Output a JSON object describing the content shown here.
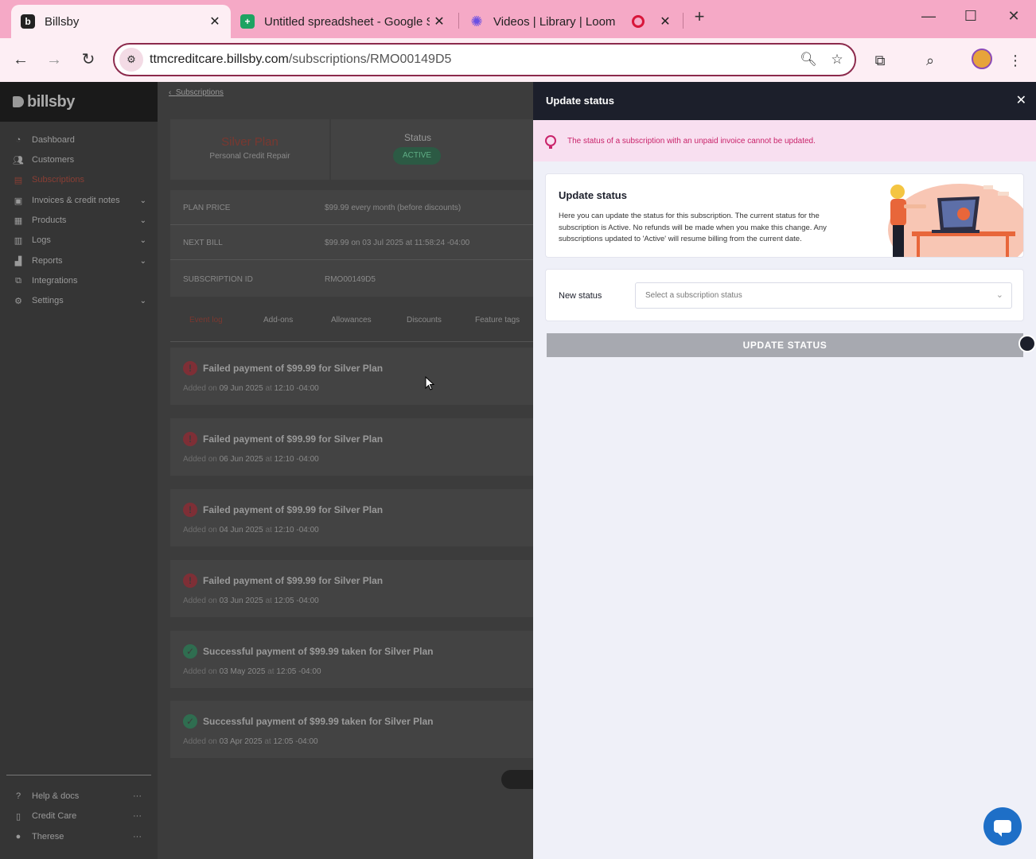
{
  "browser": {
    "tabs": [
      {
        "title": "Billsby",
        "favicon": "billsby-favicon",
        "close": "✕"
      },
      {
        "title": "Untitled spreadsheet - Google S",
        "favicon": "google-sheets-favicon",
        "close": "✕"
      },
      {
        "title": "Videos | Library | Loom",
        "favicon": "loom-favicon",
        "close": "✕"
      }
    ],
    "new_tab": "+",
    "url_domain": "ttmcreditcare.billsby.com",
    "url_path": "/subscriptions/RMO00149D5"
  },
  "sidebar": {
    "brand": "billsby",
    "items": [
      {
        "label": "Dashboard",
        "icon": "dashboard-icon"
      },
      {
        "label": "Customers",
        "icon": "customers-icon"
      },
      {
        "label": "Subscriptions",
        "icon": "subscriptions-icon"
      },
      {
        "label": "Invoices & credit notes",
        "icon": "invoices-icon"
      },
      {
        "label": "Products",
        "icon": "products-icon"
      },
      {
        "label": "Logs",
        "icon": "logs-icon"
      },
      {
        "label": "Reports",
        "icon": "reports-icon"
      },
      {
        "label": "Integrations",
        "icon": "integrations-icon"
      },
      {
        "label": "Settings",
        "icon": "settings-icon"
      }
    ],
    "footer": [
      {
        "label": "Help & docs",
        "icon": "help-icon"
      },
      {
        "label": "Credit Care",
        "icon": "building-icon"
      },
      {
        "label": "Therese",
        "icon": "user-icon"
      }
    ]
  },
  "main": {
    "breadcrumb": "Subscriptions",
    "plan_name": "Silver Plan",
    "plan_subtitle": "Personal Credit Repair",
    "status_label": "Status",
    "status_value": "ACTIVE",
    "details": [
      {
        "key": "PLAN PRICE",
        "value": "$99.99 every month (before discounts)"
      },
      {
        "key": "NEXT BILL",
        "value": "$99.99 on 03 Jul 2025 at 11:58:24 -04:00"
      },
      {
        "key": "SUBSCRIPTION ID",
        "value": "RMO00149D5"
      }
    ],
    "tabs": [
      "Event log",
      "Add-ons",
      "Allowances",
      "Discounts",
      "Feature tags"
    ],
    "events": [
      {
        "type": "fail",
        "title": "Failed payment of $99.99 for Silver Plan",
        "prefix": "Added on",
        "date": "09 Jun 2025",
        "at": "at",
        "time": "12:10 -04:00"
      },
      {
        "type": "fail",
        "title": "Failed payment of $99.99 for Silver Plan",
        "prefix": "Added on",
        "date": "06 Jun 2025",
        "at": "at",
        "time": "12:10 -04:00"
      },
      {
        "type": "fail",
        "title": "Failed payment of $99.99 for Silver Plan",
        "prefix": "Added on",
        "date": "04 Jun 2025",
        "at": "at",
        "time": "12:10 -04:00"
      },
      {
        "type": "fail",
        "title": "Failed payment of $99.99 for Silver Plan",
        "prefix": "Added on",
        "date": "03 Jun 2025",
        "at": "at",
        "time": "12:05 -04:00"
      },
      {
        "type": "ok",
        "title": "Successful payment of $99.99 taken for Silver Plan",
        "prefix": "Added on",
        "date": "03 May 2025",
        "at": "at",
        "time": "12:05 -04:00"
      },
      {
        "type": "ok",
        "title": "Successful payment of $99.99 taken for Silver Plan",
        "prefix": "Added on",
        "date": "03 Apr 2025",
        "at": "at",
        "time": "12:05 -04:00"
      }
    ]
  },
  "panel": {
    "title": "Update status",
    "alert": "The status of a subscription with an unpaid invoice cannot be updated.",
    "info_title": "Update status",
    "info_text": "Here you can update the status for this subscription. The current status for the subscription is Active. No refunds will be made when you make this change. Any subscriptions updated to 'Active' will resume billing from the current date.",
    "new_status_label": "New status",
    "select_placeholder": "Select a subscription status",
    "button": "UPDATE STATUS"
  },
  "colors": {
    "tabbar": "#f5a9c6",
    "panel_head": "#1c1f2b",
    "alert_text": "#c9236a",
    "chat": "#1e6fc7"
  }
}
